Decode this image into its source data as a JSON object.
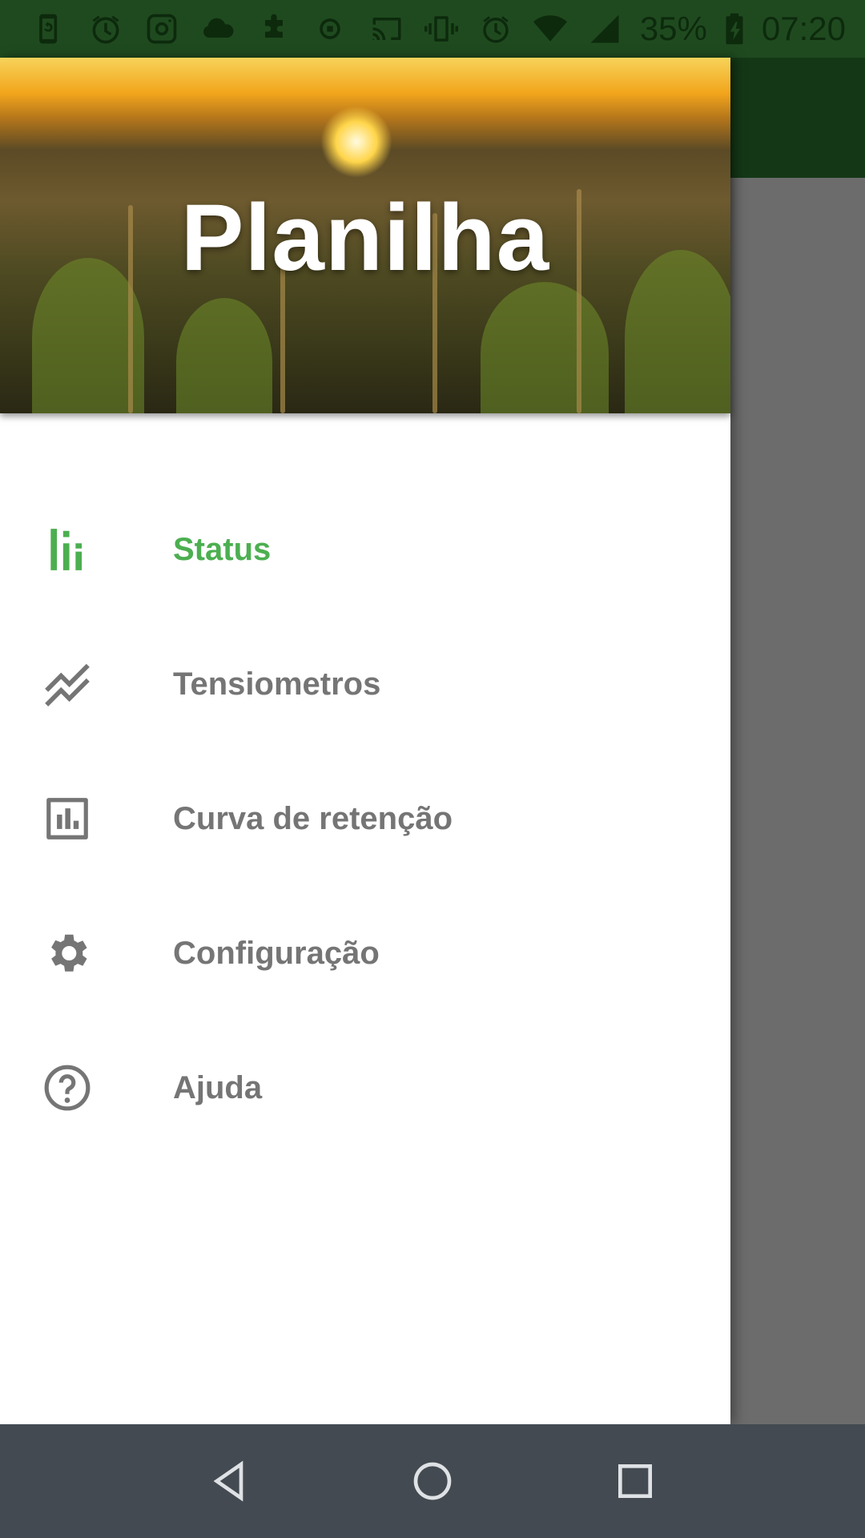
{
  "status_bar": {
    "battery": "35%",
    "time": "07:20",
    "left_icons": [
      "phone-sync-icon",
      "alarm-icon",
      "instagram-icon",
      "cloud-icon",
      "puzzle-icon",
      "screen-record-icon"
    ],
    "right_icons": [
      "cast-icon",
      "vibrate-icon",
      "alarm-icon",
      "wifi-icon",
      "signal-icon",
      "battery-icon"
    ]
  },
  "drawer": {
    "header_title": "Planilha",
    "items": [
      {
        "label": "Status",
        "icon": "bar-chart-icon",
        "active": true
      },
      {
        "label": "Tensiometros",
        "icon": "trending-lines-icon",
        "active": false
      },
      {
        "label": "Curva de retenção",
        "icon": "chart-box-icon",
        "active": false
      },
      {
        "label": "Configuração",
        "icon": "gear-icon",
        "active": false
      },
      {
        "label": "Ajuda",
        "icon": "help-circle-icon",
        "active": false
      }
    ]
  },
  "colors": {
    "accent": "#4caf50",
    "toolbar": "#2e7d32",
    "inactive_text": "#757575",
    "nav_bar": "#434a51"
  },
  "nav_bar": {
    "buttons": [
      "back-icon",
      "home-icon",
      "recents-icon"
    ]
  }
}
